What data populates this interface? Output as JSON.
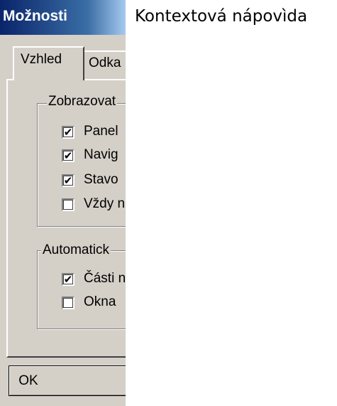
{
  "dialog": {
    "title": "Možnosti",
    "tabs": [
      {
        "label": "Vzhled",
        "active": true
      },
      {
        "label": "Odka",
        "active": false
      }
    ],
    "groups": [
      {
        "legend": "Zobrazovat",
        "options": [
          {
            "label": "Panel",
            "checked": true,
            "check_glyph": "✔"
          },
          {
            "label": "Navig",
            "checked": true,
            "check_glyph": "✔"
          },
          {
            "label": "Stavo",
            "checked": true,
            "check_glyph": "✔"
          },
          {
            "label": "Vždy n",
            "checked": false,
            "check_glyph": ""
          }
        ]
      },
      {
        "legend": "Automatick",
        "options": [
          {
            "label": "Části n",
            "checked": true,
            "check_glyph": "✔"
          },
          {
            "label": "Okna",
            "checked": false,
            "check_glyph": ""
          }
        ]
      }
    ],
    "ok_label": "OK"
  },
  "context_help": {
    "title": "Kontextová nápovìda"
  }
}
